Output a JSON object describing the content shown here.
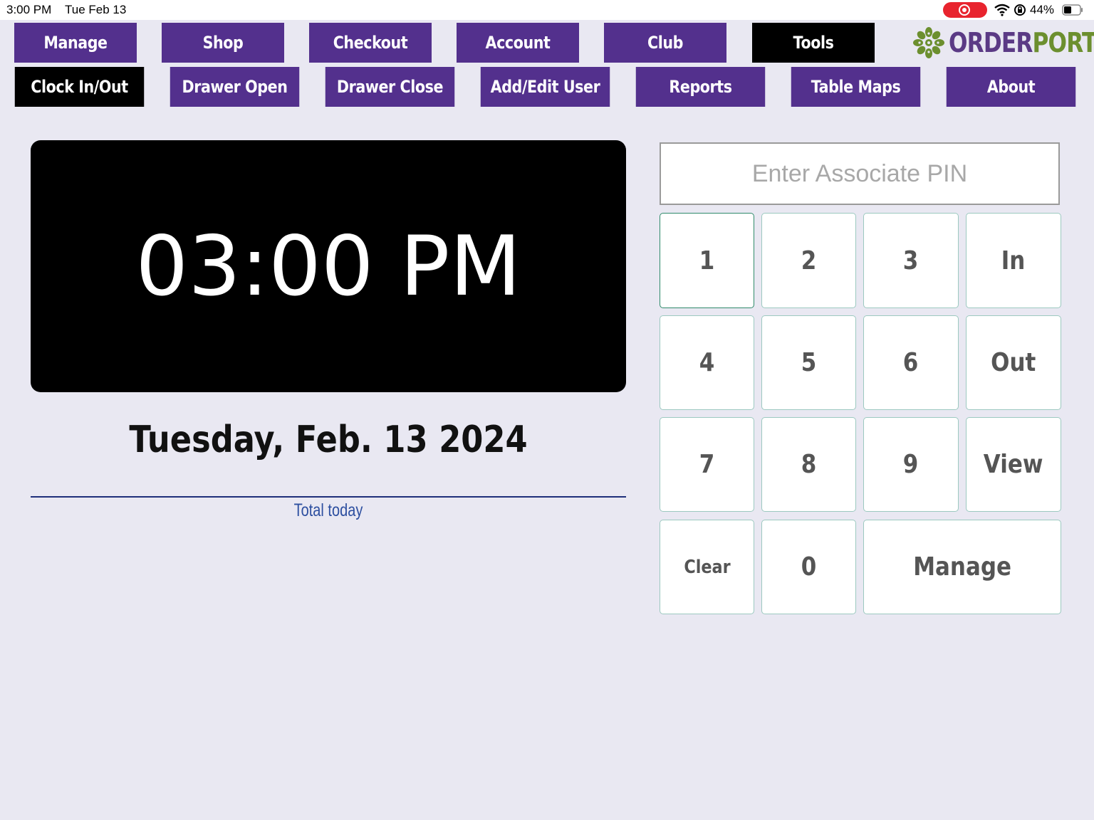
{
  "status_bar": {
    "time": "3:00 PM",
    "date": "Tue Feb 13",
    "battery_percent": "44%"
  },
  "nav": {
    "top_tabs": [
      {
        "label": "Manage"
      },
      {
        "label": "Shop"
      },
      {
        "label": "Checkout"
      },
      {
        "label": "Account"
      },
      {
        "label": "Club"
      },
      {
        "label": "Tools",
        "active": true
      }
    ],
    "sub_tabs": [
      {
        "label": "Clock In/Out",
        "active": true
      },
      {
        "label": "Drawer Open"
      },
      {
        "label": "Drawer Close"
      },
      {
        "label": "Add/Edit User"
      },
      {
        "label": "Reports"
      },
      {
        "label": "Table Maps"
      },
      {
        "label": "About"
      }
    ]
  },
  "logo": {
    "part1": "ORDER",
    "part2": "PORT"
  },
  "clock": {
    "time": "03:00 PM",
    "date": "Tuesday, Feb. 13 2024",
    "total_label": "Total today"
  },
  "pinpad": {
    "placeholder": "Enter Associate PIN",
    "value": "",
    "keys": {
      "k1": "1",
      "k2": "2",
      "k3": "3",
      "in": "In",
      "k4": "4",
      "k5": "5",
      "k6": "6",
      "out": "Out",
      "k7": "7",
      "k8": "8",
      "k9": "9",
      "view": "View",
      "clear": "Clear",
      "k0": "0",
      "manage": "Manage"
    }
  },
  "colors": {
    "nav_purple": "#53308d",
    "nav_active": "#000000",
    "background": "#e9e8f2",
    "logo_purple": "#5b3a85",
    "logo_green": "#6c8f2f"
  }
}
